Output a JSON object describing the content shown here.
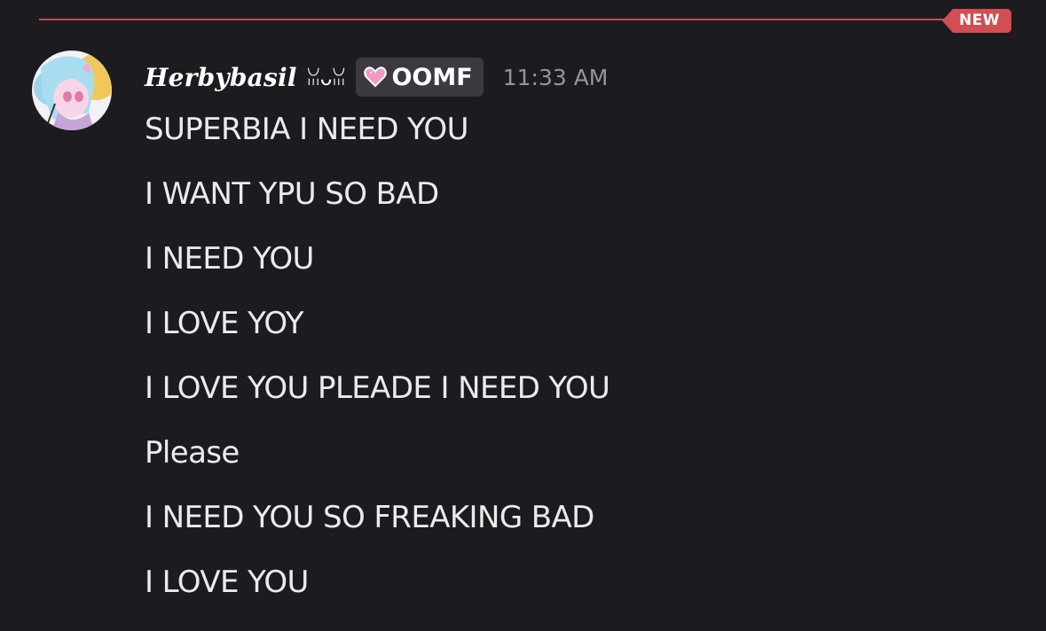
{
  "divider": {
    "label": "NEW"
  },
  "message": {
    "author": {
      "name": "Herbybasil",
      "decoration": "ꈍᴗꈍ",
      "tag_icon": "pink-heart-icon",
      "tag": "OOMF"
    },
    "timestamp": "11:33 AM",
    "lines": [
      "SUPERBIA I NEED YOU",
      "I WANT YPU SO BAD",
      "I NEED YOU",
      "I LOVE YOY",
      "I LOVE YOU PLEADE I NEED YOU",
      "Please",
      "I NEED YOU SO FREAKING BAD",
      "I LOVE YOU"
    ]
  },
  "colors": {
    "background": "#1c1b20",
    "new_accent": "#d14e52",
    "tag_background": "#3a3a40",
    "timestamp": "#95959c",
    "text": "#ebebed"
  }
}
